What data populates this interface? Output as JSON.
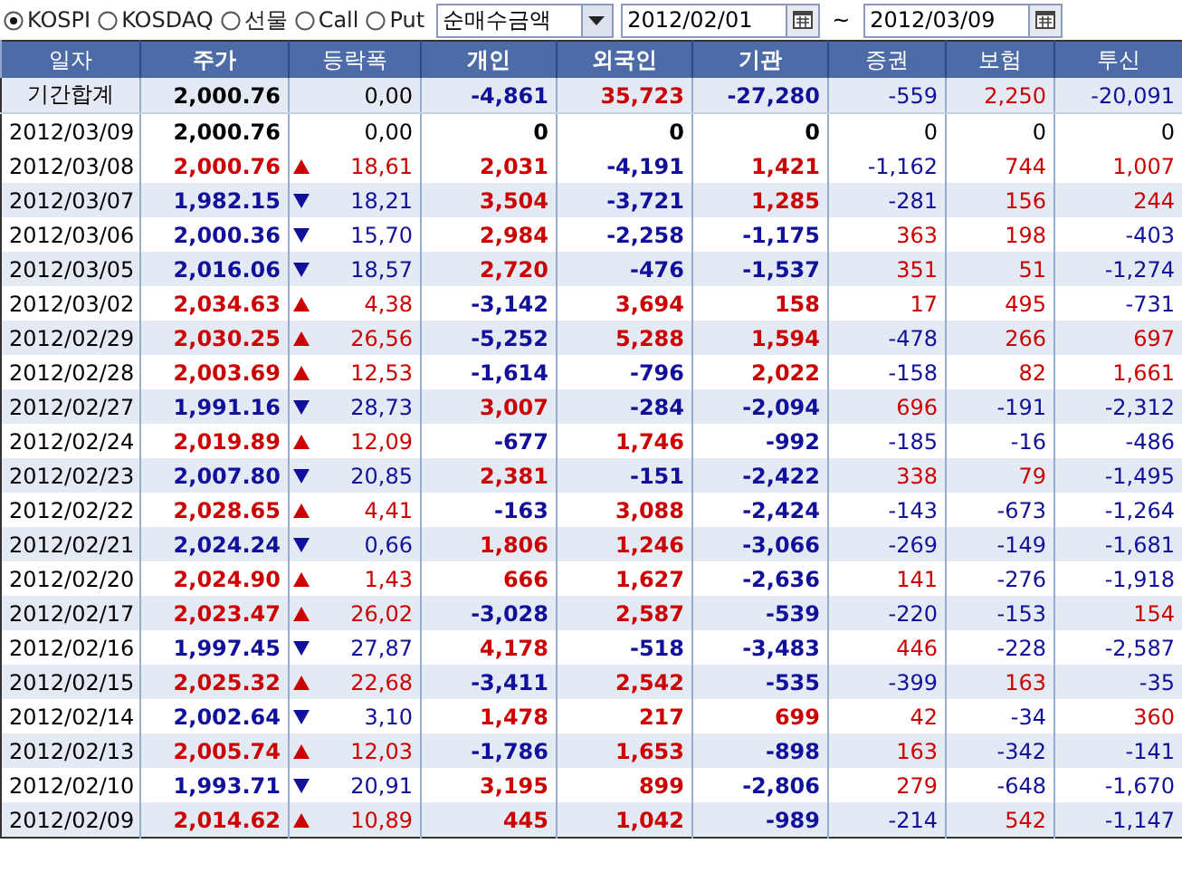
{
  "markets": [
    {
      "label": "KOSPI",
      "selected": true
    },
    {
      "label": "KOSDAQ",
      "selected": false
    },
    {
      "label": "선물",
      "selected": false
    },
    {
      "label": "Call",
      "selected": false
    },
    {
      "label": "Put",
      "selected": false
    }
  ],
  "measure": {
    "value": "순매수금액"
  },
  "date_from": {
    "value": "2012/02/01"
  },
  "range_sep": "~",
  "date_to": {
    "value": "2012/03/09"
  },
  "columns": [
    "일자",
    "주가",
    "등락폭",
    "개인",
    "외국인",
    "기관",
    "증권",
    "보험",
    "투신"
  ],
  "summary": {
    "label": "기간합계",
    "price": "2,000.76",
    "change": "0,00",
    "flows": [
      {
        "text": "-4,861",
        "color": "#10109a"
      },
      {
        "text": "35,723",
        "color": "#cc0000"
      },
      {
        "text": "-27,280",
        "color": "#10109a"
      },
      {
        "text": "-559",
        "color": "#10109a"
      },
      {
        "text": "2,250",
        "color": "#cc0000"
      },
      {
        "text": "-20,091",
        "color": "#10109a"
      }
    ]
  },
  "rows": [
    {
      "date": "2012/03/09",
      "price": "2,000.76",
      "kind": "flat",
      "change": "0,00",
      "flows": [
        {
          "text": "0",
          "color": "#000000"
        },
        {
          "text": "0",
          "color": "#000000"
        },
        {
          "text": "0",
          "color": "#000000"
        },
        {
          "text": "0",
          "color": "#000000"
        },
        {
          "text": "0",
          "color": "#000000"
        },
        {
          "text": "0",
          "color": "#000000"
        }
      ]
    },
    {
      "date": "2012/03/08",
      "price": "2,000.76",
      "kind": "up",
      "change": "18,61",
      "flows": [
        {
          "text": "2,031",
          "color": "#cc0000"
        },
        {
          "text": "-4,191",
          "color": "#10109a"
        },
        {
          "text": "1,421",
          "color": "#cc0000"
        },
        {
          "text": "-1,162",
          "color": "#10109a"
        },
        {
          "text": "744",
          "color": "#cc0000"
        },
        {
          "text": "1,007",
          "color": "#cc0000"
        }
      ]
    },
    {
      "date": "2012/03/07",
      "price": "1,982.15",
      "kind": "down",
      "change": "18,21",
      "flows": [
        {
          "text": "3,504",
          "color": "#cc0000"
        },
        {
          "text": "-3,721",
          "color": "#10109a"
        },
        {
          "text": "1,285",
          "color": "#cc0000"
        },
        {
          "text": "-281",
          "color": "#10109a"
        },
        {
          "text": "156",
          "color": "#cc0000"
        },
        {
          "text": "244",
          "color": "#cc0000"
        }
      ]
    },
    {
      "date": "2012/03/06",
      "price": "2,000.36",
      "kind": "down",
      "change": "15,70",
      "flows": [
        {
          "text": "2,984",
          "color": "#cc0000"
        },
        {
          "text": "-2,258",
          "color": "#10109a"
        },
        {
          "text": "-1,175",
          "color": "#10109a"
        },
        {
          "text": "363",
          "color": "#cc0000"
        },
        {
          "text": "198",
          "color": "#cc0000"
        },
        {
          "text": "-403",
          "color": "#10109a"
        }
      ]
    },
    {
      "date": "2012/03/05",
      "price": "2,016.06",
      "kind": "down",
      "change": "18,57",
      "flows": [
        {
          "text": "2,720",
          "color": "#cc0000"
        },
        {
          "text": "-476",
          "color": "#10109a"
        },
        {
          "text": "-1,537",
          "color": "#10109a"
        },
        {
          "text": "351",
          "color": "#cc0000"
        },
        {
          "text": "51",
          "color": "#cc0000"
        },
        {
          "text": "-1,274",
          "color": "#10109a"
        }
      ]
    },
    {
      "date": "2012/03/02",
      "price": "2,034.63",
      "kind": "up",
      "change": "4,38",
      "flows": [
        {
          "text": "-3,142",
          "color": "#10109a"
        },
        {
          "text": "3,694",
          "color": "#cc0000"
        },
        {
          "text": "158",
          "color": "#cc0000"
        },
        {
          "text": "17",
          "color": "#cc0000"
        },
        {
          "text": "495",
          "color": "#cc0000"
        },
        {
          "text": "-731",
          "color": "#10109a"
        }
      ]
    },
    {
      "date": "2012/02/29",
      "price": "2,030.25",
      "kind": "up",
      "change": "26,56",
      "flows": [
        {
          "text": "-5,252",
          "color": "#10109a"
        },
        {
          "text": "5,288",
          "color": "#cc0000"
        },
        {
          "text": "1,594",
          "color": "#cc0000"
        },
        {
          "text": "-478",
          "color": "#10109a"
        },
        {
          "text": "266",
          "color": "#cc0000"
        },
        {
          "text": "697",
          "color": "#cc0000"
        }
      ]
    },
    {
      "date": "2012/02/28",
      "price": "2,003.69",
      "kind": "up",
      "change": "12,53",
      "flows": [
        {
          "text": "-1,614",
          "color": "#10109a"
        },
        {
          "text": "-796",
          "color": "#10109a"
        },
        {
          "text": "2,022",
          "color": "#cc0000"
        },
        {
          "text": "-158",
          "color": "#10109a"
        },
        {
          "text": "82",
          "color": "#cc0000"
        },
        {
          "text": "1,661",
          "color": "#cc0000"
        }
      ]
    },
    {
      "date": "2012/02/27",
      "price": "1,991.16",
      "kind": "down",
      "change": "28,73",
      "flows": [
        {
          "text": "3,007",
          "color": "#cc0000"
        },
        {
          "text": "-284",
          "color": "#10109a"
        },
        {
          "text": "-2,094",
          "color": "#10109a"
        },
        {
          "text": "696",
          "color": "#cc0000"
        },
        {
          "text": "-191",
          "color": "#10109a"
        },
        {
          "text": "-2,312",
          "color": "#10109a"
        }
      ]
    },
    {
      "date": "2012/02/24",
      "price": "2,019.89",
      "kind": "up",
      "change": "12,09",
      "flows": [
        {
          "text": "-677",
          "color": "#10109a"
        },
        {
          "text": "1,746",
          "color": "#cc0000"
        },
        {
          "text": "-992",
          "color": "#10109a"
        },
        {
          "text": "-185",
          "color": "#10109a"
        },
        {
          "text": "-16",
          "color": "#10109a"
        },
        {
          "text": "-486",
          "color": "#10109a"
        }
      ]
    },
    {
      "date": "2012/02/23",
      "price": "2,007.80",
      "kind": "down",
      "change": "20,85",
      "flows": [
        {
          "text": "2,381",
          "color": "#cc0000"
        },
        {
          "text": "-151",
          "color": "#10109a"
        },
        {
          "text": "-2,422",
          "color": "#10109a"
        },
        {
          "text": "338",
          "color": "#cc0000"
        },
        {
          "text": "79",
          "color": "#cc0000"
        },
        {
          "text": "-1,495",
          "color": "#10109a"
        }
      ]
    },
    {
      "date": "2012/02/22",
      "price": "2,028.65",
      "kind": "up",
      "change": "4,41",
      "flows": [
        {
          "text": "-163",
          "color": "#10109a"
        },
        {
          "text": "3,088",
          "color": "#cc0000"
        },
        {
          "text": "-2,424",
          "color": "#10109a"
        },
        {
          "text": "-143",
          "color": "#10109a"
        },
        {
          "text": "-673",
          "color": "#10109a"
        },
        {
          "text": "-1,264",
          "color": "#10109a"
        }
      ]
    },
    {
      "date": "2012/02/21",
      "price": "2,024.24",
      "kind": "down",
      "change": "0,66",
      "flows": [
        {
          "text": "1,806",
          "color": "#cc0000"
        },
        {
          "text": "1,246",
          "color": "#cc0000"
        },
        {
          "text": "-3,066",
          "color": "#10109a"
        },
        {
          "text": "-269",
          "color": "#10109a"
        },
        {
          "text": "-149",
          "color": "#10109a"
        },
        {
          "text": "-1,681",
          "color": "#10109a"
        }
      ]
    },
    {
      "date": "2012/02/20",
      "price": "2,024.90",
      "kind": "up",
      "change": "1,43",
      "flows": [
        {
          "text": "666",
          "color": "#cc0000"
        },
        {
          "text": "1,627",
          "color": "#cc0000"
        },
        {
          "text": "-2,636",
          "color": "#10109a"
        },
        {
          "text": "141",
          "color": "#cc0000"
        },
        {
          "text": "-276",
          "color": "#10109a"
        },
        {
          "text": "-1,918",
          "color": "#10109a"
        }
      ]
    },
    {
      "date": "2012/02/17",
      "price": "2,023.47",
      "kind": "up",
      "change": "26,02",
      "flows": [
        {
          "text": "-3,028",
          "color": "#10109a"
        },
        {
          "text": "2,587",
          "color": "#cc0000"
        },
        {
          "text": "-539",
          "color": "#10109a"
        },
        {
          "text": "-220",
          "color": "#10109a"
        },
        {
          "text": "-153",
          "color": "#10109a"
        },
        {
          "text": "154",
          "color": "#cc0000"
        }
      ]
    },
    {
      "date": "2012/02/16",
      "price": "1,997.45",
      "kind": "down",
      "change": "27,87",
      "flows": [
        {
          "text": "4,178",
          "color": "#cc0000"
        },
        {
          "text": "-518",
          "color": "#10109a"
        },
        {
          "text": "-3,483",
          "color": "#10109a"
        },
        {
          "text": "446",
          "color": "#cc0000"
        },
        {
          "text": "-228",
          "color": "#10109a"
        },
        {
          "text": "-2,587",
          "color": "#10109a"
        }
      ]
    },
    {
      "date": "2012/02/15",
      "price": "2,025.32",
      "kind": "up",
      "change": "22,68",
      "flows": [
        {
          "text": "-3,411",
          "color": "#10109a"
        },
        {
          "text": "2,542",
          "color": "#cc0000"
        },
        {
          "text": "-535",
          "color": "#10109a"
        },
        {
          "text": "-399",
          "color": "#10109a"
        },
        {
          "text": "163",
          "color": "#cc0000"
        },
        {
          "text": "-35",
          "color": "#10109a"
        }
      ]
    },
    {
      "date": "2012/02/14",
      "price": "2,002.64",
      "kind": "down",
      "change": "3,10",
      "flows": [
        {
          "text": "1,478",
          "color": "#cc0000"
        },
        {
          "text": "217",
          "color": "#cc0000"
        },
        {
          "text": "699",
          "color": "#cc0000"
        },
        {
          "text": "42",
          "color": "#cc0000"
        },
        {
          "text": "-34",
          "color": "#10109a"
        },
        {
          "text": "360",
          "color": "#cc0000"
        }
      ]
    },
    {
      "date": "2012/02/13",
      "price": "2,005.74",
      "kind": "up",
      "change": "12,03",
      "flows": [
        {
          "text": "-1,786",
          "color": "#10109a"
        },
        {
          "text": "1,653",
          "color": "#cc0000"
        },
        {
          "text": "-898",
          "color": "#10109a"
        },
        {
          "text": "163",
          "color": "#cc0000"
        },
        {
          "text": "-342",
          "color": "#10109a"
        },
        {
          "text": "-141",
          "color": "#10109a"
        }
      ]
    },
    {
      "date": "2012/02/10",
      "price": "1,993.71",
      "kind": "down",
      "change": "20,91",
      "flows": [
        {
          "text": "3,195",
          "color": "#cc0000"
        },
        {
          "text": "899",
          "color": "#cc0000"
        },
        {
          "text": "-2,806",
          "color": "#10109a"
        },
        {
          "text": "279",
          "color": "#cc0000"
        },
        {
          "text": "-648",
          "color": "#10109a"
        },
        {
          "text": "-1,670",
          "color": "#10109a"
        }
      ]
    },
    {
      "date": "2012/02/09",
      "price": "2,014.62",
      "kind": "up",
      "change": "10,89",
      "flows": [
        {
          "text": "445",
          "color": "#cc0000"
        },
        {
          "text": "1,042",
          "color": "#cc0000"
        },
        {
          "text": "-989",
          "color": "#10109a"
        },
        {
          "text": "-214",
          "color": "#10109a"
        },
        {
          "text": "542",
          "color": "#cc0000"
        },
        {
          "text": "-1,147",
          "color": "#10109a"
        }
      ]
    }
  ]
}
